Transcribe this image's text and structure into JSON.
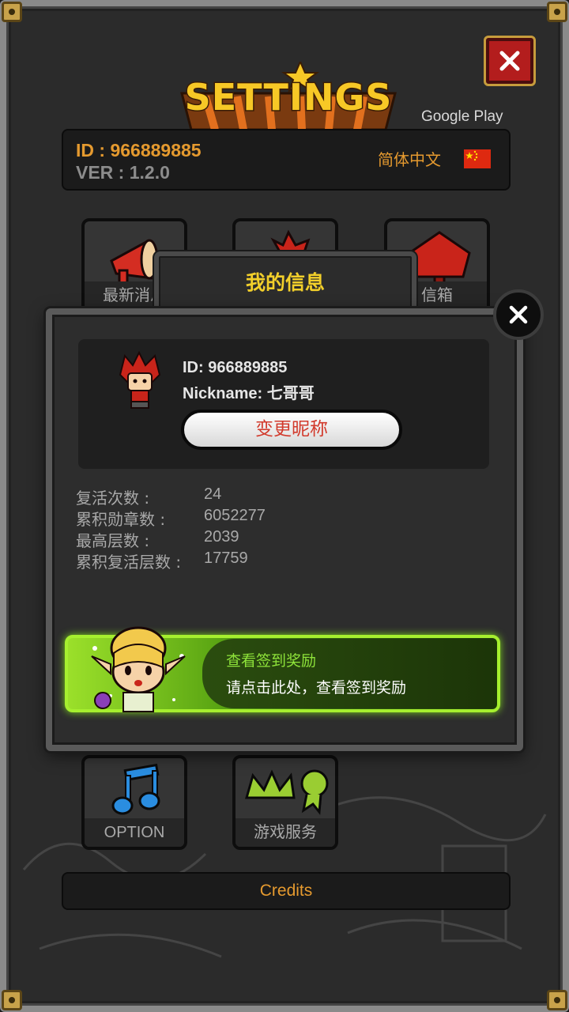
{
  "header": {
    "title": "SETTINGS",
    "store": "Google Play",
    "id_line": "ID : 966889885",
    "version_line": "VER : 1.2.0",
    "language": "简体中文",
    "flag_icon": "china-flag-icon"
  },
  "tiles": [
    {
      "label": "最新消息",
      "icon": "megaphone-icon"
    },
    {
      "label": "",
      "icon": "red-badge-icon"
    },
    {
      "label": "信箱",
      "icon": "mailbox-icon"
    },
    {
      "label": "OPTION",
      "icon": "music-note-icon"
    },
    {
      "label": "游戏服务",
      "icon": "crown-medal-icon"
    }
  ],
  "credits_label": "Credits",
  "modal": {
    "title": "我的信息",
    "profile": {
      "id": "ID: 966889885",
      "nickname": "Nickname: 七哥哥",
      "change_nickname_label": "变更昵称"
    },
    "stats": [
      {
        "label": "复活次数 :",
        "value": "24"
      },
      {
        "label": "累积勋章数 :",
        "value": "6052277"
      },
      {
        "label": "最高层数 :",
        "value": "2039"
      },
      {
        "label": "累积复活层数 :",
        "value": "17759"
      }
    ],
    "banner": {
      "title": "查看签到奖励",
      "subtitle": "请点击此处，查看签到奖励"
    }
  },
  "colors": {
    "accent_orange": "#e59a2f",
    "title_yellow": "#f7c826",
    "close_red": "#b31d1d",
    "banner_green": "#a6ef2f"
  }
}
